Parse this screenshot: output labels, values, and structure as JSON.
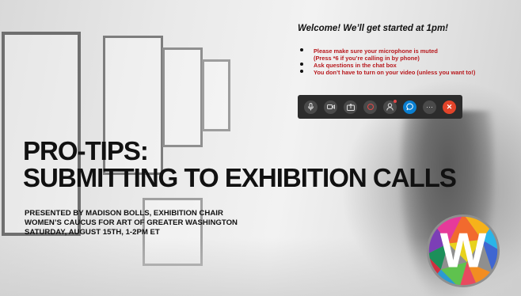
{
  "notice": {
    "welcome": "Welcome! We’ll get started at 1pm!",
    "items": [
      "Please make sure your microphone is muted",
      "(Press *6 if you’re calling in by phone)",
      "Ask questions in the chat box",
      "You don’t have to turn on your video (unless you want to!)"
    ]
  },
  "toolbar": {
    "buttons": [
      "microphone-icon",
      "video-icon",
      "share-screen-icon",
      "record-icon",
      "participants-icon",
      "chat-icon",
      "more-icon",
      "end-call-icon"
    ],
    "more_label": "···",
    "end_label": "✕"
  },
  "title": {
    "line1": "PRO-TIPS:",
    "line2": "SUBMITTING TO EXHIBITION CALLS"
  },
  "presenter": {
    "line1": "PRESENTED BY MADISON BOLLS, EXHIBITION CHAIR",
    "line2": "WOMEN’S CAUCUS FOR ART OF GREATER WASHINGTON",
    "line3": "SATURDAY, AUGUST 15TH, 1-2PM ET"
  },
  "logo": {
    "letter": "W"
  },
  "colors": {
    "accent_red": "#b8181c",
    "toolbar_bg": "#2c2c2c",
    "share_blue": "#0a7fd1",
    "end_red": "#e2442a"
  }
}
